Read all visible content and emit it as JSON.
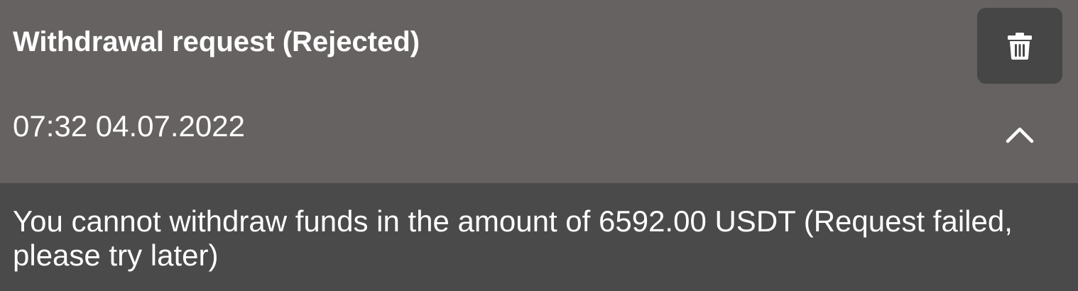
{
  "notification": {
    "title": "Withdrawal request (Rejected)",
    "timestamp": "07:32 04.07.2022",
    "message": "You cannot withdraw funds in the amount of 6592.00 USDT (Request failed, please try later)"
  },
  "icons": {
    "delete": "trash-icon",
    "collapse": "chevron-up-icon"
  },
  "colors": {
    "header_bg": "#666261",
    "body_bg": "#4a4a4a",
    "button_bg": "#464646",
    "text": "#ffffff"
  }
}
